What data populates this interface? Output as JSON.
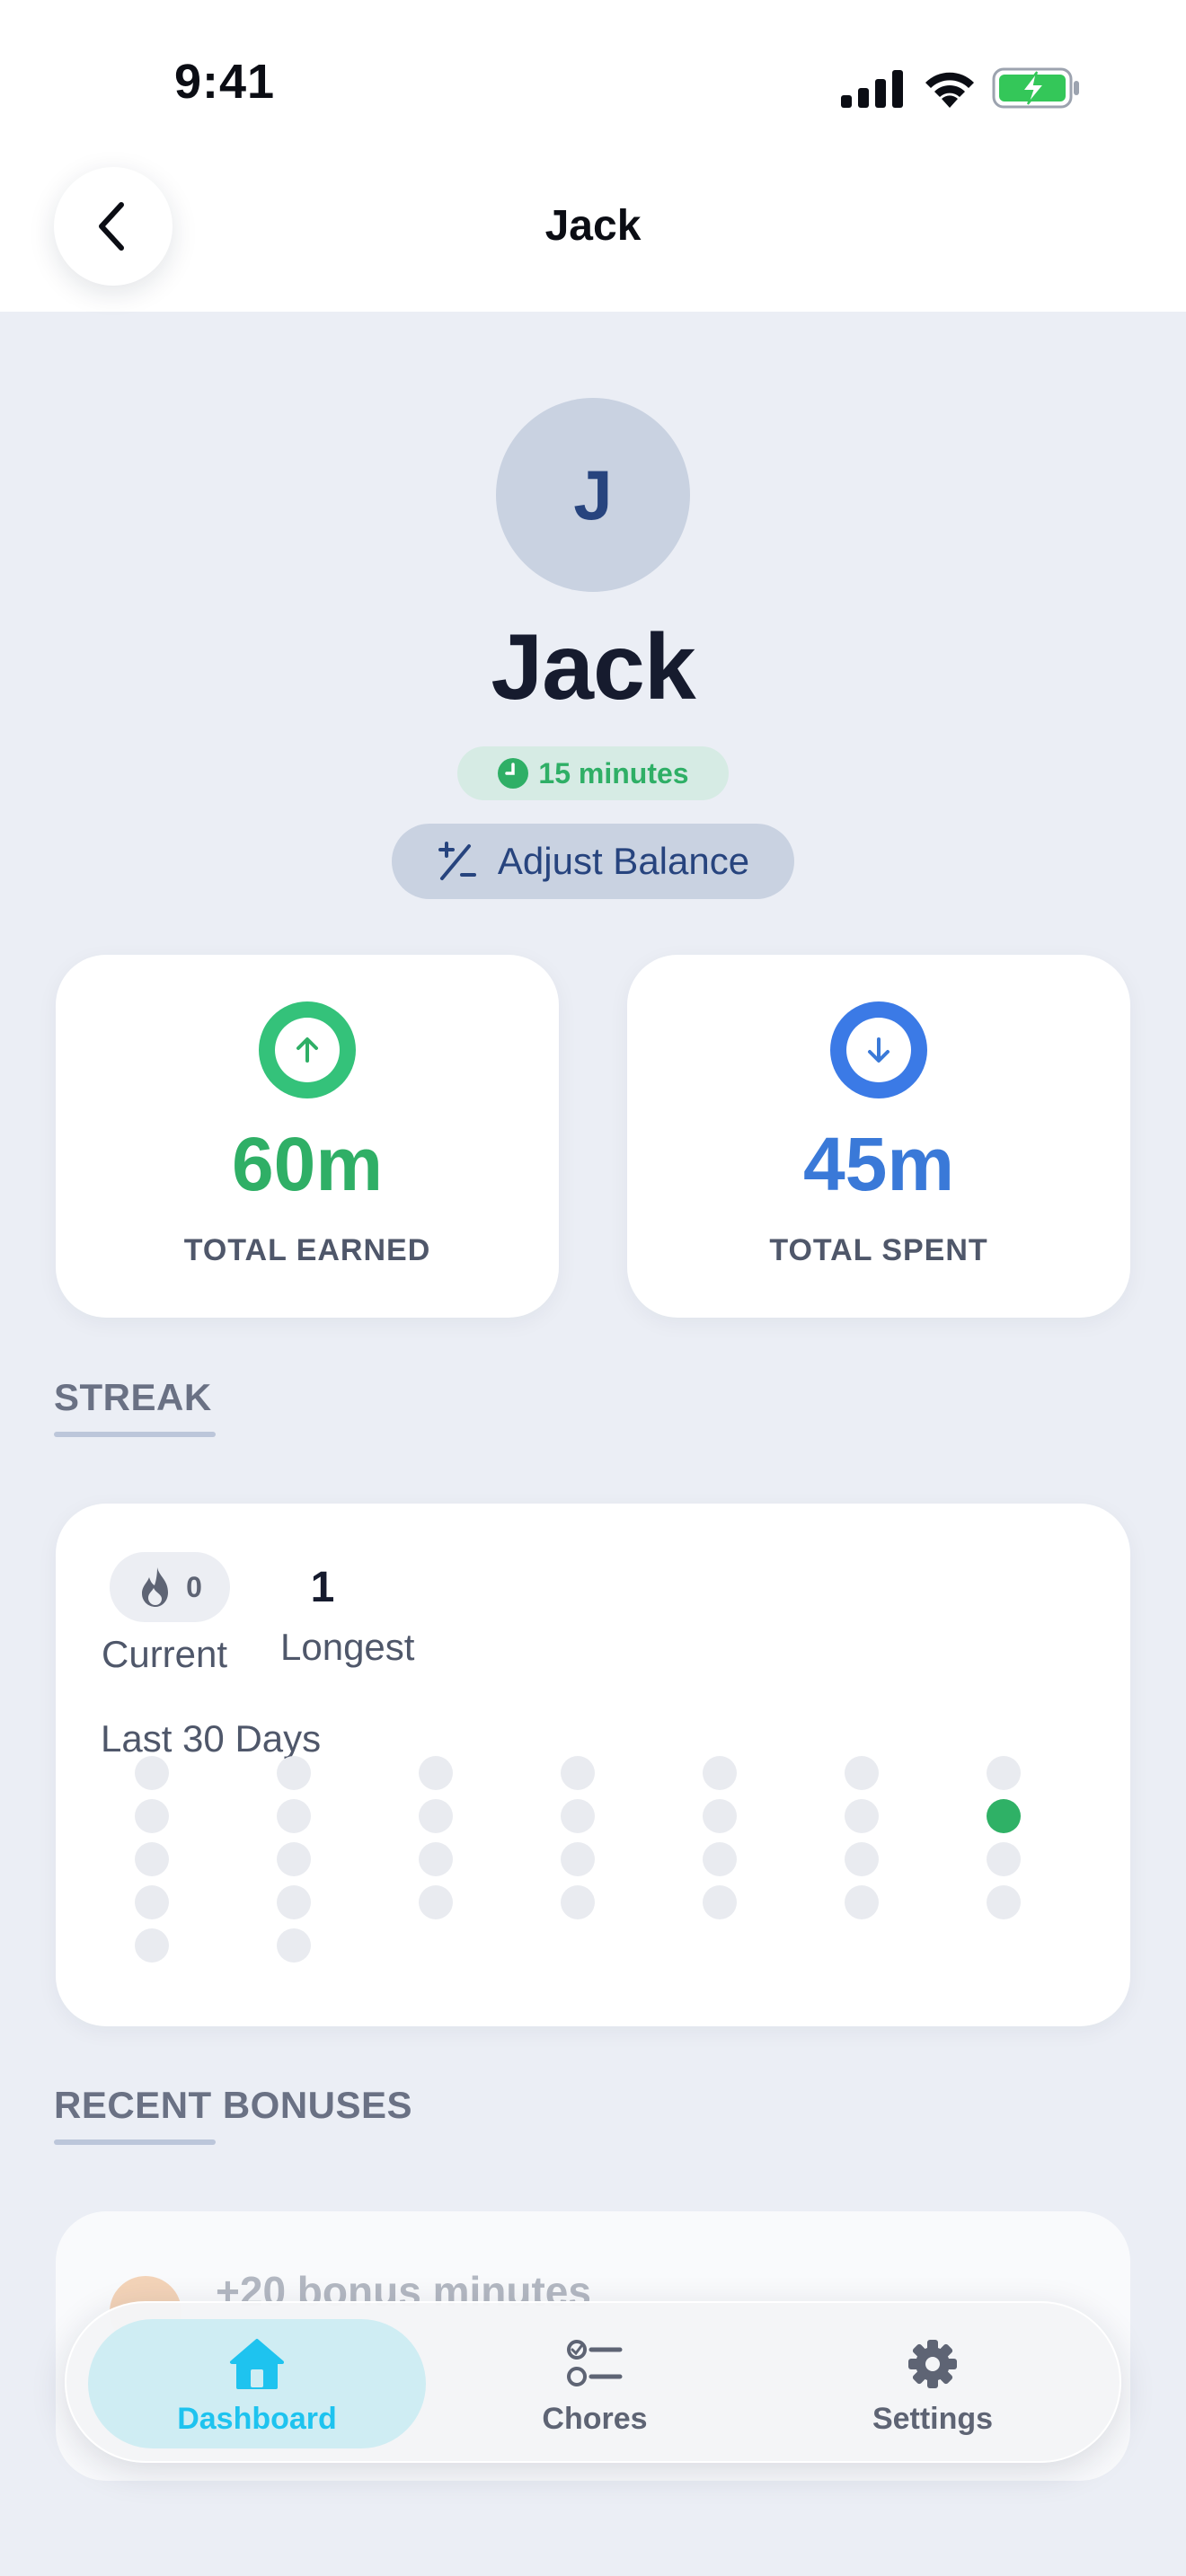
{
  "status_bar": {
    "time": "9:41",
    "icons": [
      "cellular-signal-icon",
      "wifi-icon",
      "battery-charging-icon"
    ]
  },
  "header": {
    "title": "Jack",
    "back_icon": "chevron-left-icon"
  },
  "profile": {
    "avatar_initial": "J",
    "name": "Jack",
    "balance": "15 minutes",
    "balance_icon": "clock-icon",
    "adjust_button_label": "Adjust Balance",
    "adjust_icon": "plus-minus-icon"
  },
  "stats": {
    "earned": {
      "value": "60m",
      "label": "TOTAL EARNED",
      "icon": "arrow-up-circle-icon"
    },
    "spent": {
      "value": "45m",
      "label": "TOTAL SPENT",
      "icon": "arrow-down-circle-icon"
    }
  },
  "streak": {
    "section_title": "STREAK",
    "current_value": "0",
    "current_label": "Current",
    "longest_value": "1",
    "longest_label": "Longest",
    "calendar_label": "Last 30 Days",
    "days_total": 30,
    "active_day_index": 27
  },
  "bonuses": {
    "section_title": "RECENT BONUSES",
    "items": [
      {
        "text": "+20 bonus minutes"
      }
    ]
  },
  "tab_bar": {
    "active": "dashboard",
    "tabs": [
      {
        "id": "dashboard",
        "label": "Dashboard",
        "icon": "home-icon"
      },
      {
        "id": "chores",
        "label": "Chores",
        "icon": "checklist-icon"
      },
      {
        "id": "settings",
        "label": "Settings",
        "icon": "gear-icon"
      }
    ]
  },
  "colors": {
    "earned_green": "#2faf66",
    "spent_blue": "#3a79d8",
    "active_tab_cyan": "#1ec3ef",
    "streak_active_dot": "#2fb166"
  }
}
